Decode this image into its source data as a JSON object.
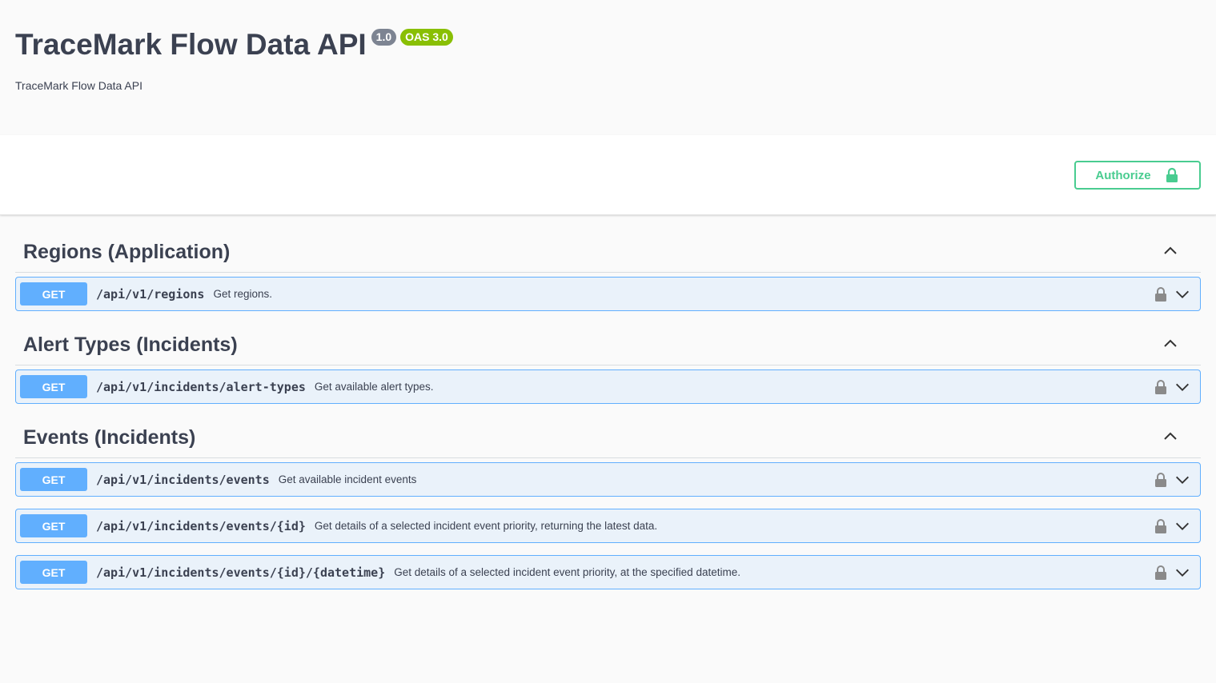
{
  "info": {
    "title": "TraceMark Flow Data API",
    "version": "1.0",
    "oas": "OAS 3.0",
    "description": "TraceMark Flow Data API"
  },
  "scheme": {
    "authorize_label": "Authorize",
    "authorize_icon": "lock-icon"
  },
  "tags": [
    {
      "name": "Regions (Application)",
      "operations": [
        {
          "method": "GET",
          "path": "/api/v1/regions",
          "summary": "Get regions."
        }
      ]
    },
    {
      "name": "Alert Types (Incidents)",
      "operations": [
        {
          "method": "GET",
          "path": "/api/v1/incidents/alert-types",
          "summary": "Get available alert types."
        }
      ]
    },
    {
      "name": "Events (Incidents)",
      "operations": [
        {
          "method": "GET",
          "path": "/api/v1/incidents/events",
          "summary": "Get available incident events"
        },
        {
          "method": "GET",
          "path": "/api/v1/incidents/events/{id}",
          "summary": "Get details of a selected incident event priority, returning the latest data."
        },
        {
          "method": "GET",
          "path": "/api/v1/incidents/events/{id}/{datetime}",
          "summary": "Get details of a selected incident event priority, at the specified datetime."
        }
      ]
    }
  ],
  "colors": {
    "get": "#61affe",
    "authorize": "#49cc90",
    "oas_badge": "#89bf04",
    "version_badge": "#7d8492"
  }
}
